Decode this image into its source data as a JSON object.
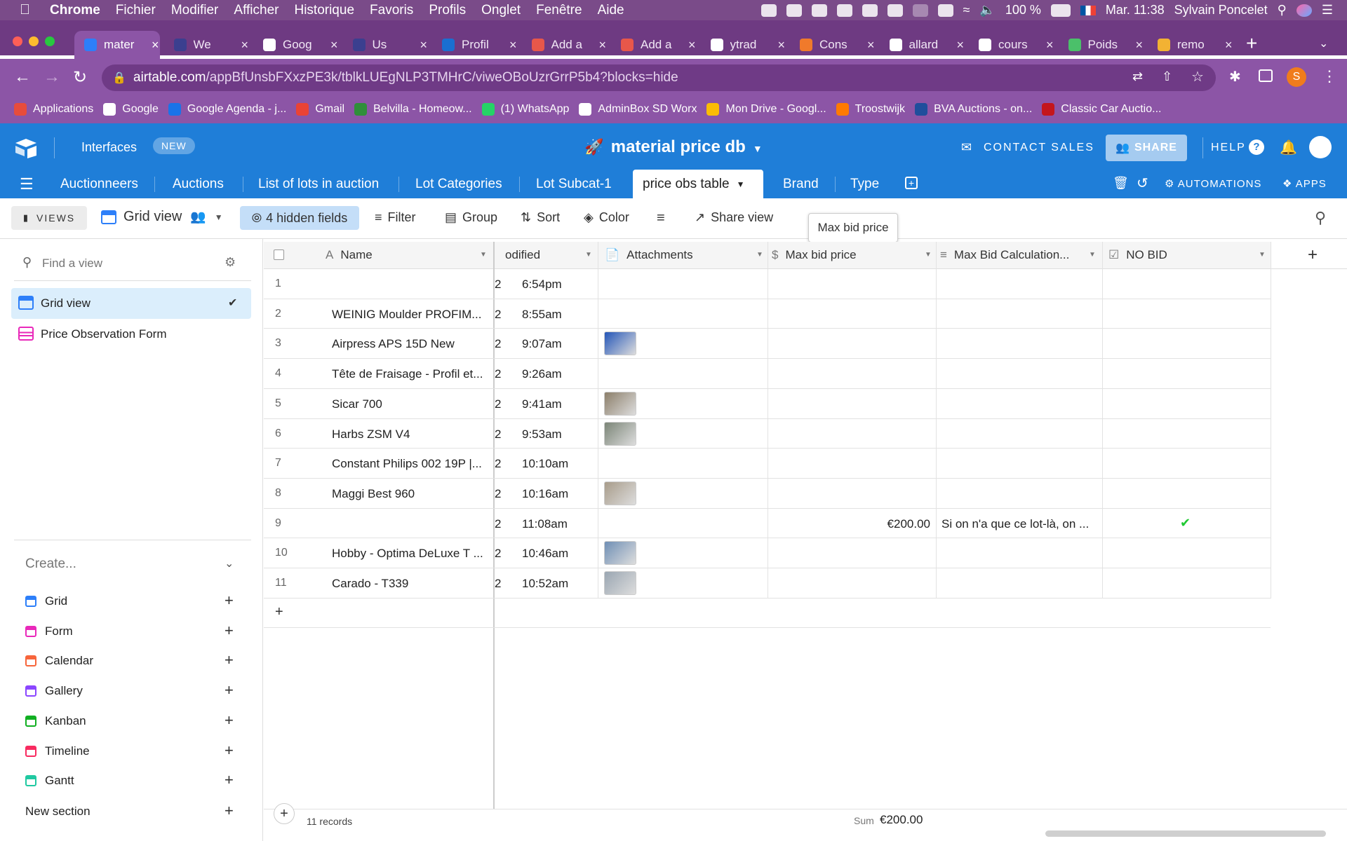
{
  "menubar": {
    "apple": "",
    "app": "Chrome",
    "items": [
      "Fichier",
      "Modifier",
      "Afficher",
      "Historique",
      "Favoris",
      "Profils",
      "Onglet",
      "Fenêtre",
      "Aide"
    ],
    "battery": "100 %",
    "clock": "Mar. 11:38",
    "user": "Sylvain Poncelet"
  },
  "tabs": [
    {
      "label": "mater",
      "color": "#2d7ff9",
      "active": true
    },
    {
      "label": "We",
      "color": "#3b3f8f"
    },
    {
      "label": "Goog",
      "color": "#ffffff"
    },
    {
      "label": "Us",
      "color": "#3b3f8f"
    },
    {
      "label": "Profil",
      "color": "#1a6fd1"
    },
    {
      "label": "Add a",
      "color": "#e8574a"
    },
    {
      "label": "Add a",
      "color": "#e8574a"
    },
    {
      "label": "ytrad",
      "color": "#ffffff"
    },
    {
      "label": "Cons",
      "color": "#f07a2b"
    },
    {
      "label": "allard",
      "color": "#ffffff"
    },
    {
      "label": "cours",
      "color": "#ffffff"
    },
    {
      "label": "Poids",
      "color": "#4bc06a"
    },
    {
      "label": "remo",
      "color": "#f2b233"
    }
  ],
  "newtab": "+",
  "address": {
    "host": "airtable.com",
    "path": "/appBfUnsbFXxzPE3k/tblkLUEgNLP3TMHrC/viweOBoUzrGrrP5b4?blocks=hide"
  },
  "profile_initial": "S",
  "bookmarks": [
    {
      "label": "Applications",
      "color": "#e74c3c"
    },
    {
      "label": "Google",
      "color": "#ffffff"
    },
    {
      "label": "Google Agenda - j...",
      "color": "#1a73e8"
    },
    {
      "label": "Gmail",
      "color": "#ea4335"
    },
    {
      "label": "Belvilla - Homeow...",
      "color": "#2f8f3a"
    },
    {
      "label": "(1) WhatsApp",
      "color": "#25d366"
    },
    {
      "label": "AdminBox SD Worx",
      "color": "#ffffff"
    },
    {
      "label": "Mon Drive - Googl...",
      "color": "#fbbc05"
    },
    {
      "label": "Troostwijk",
      "color": "#ff7a00"
    },
    {
      "label": "BVA Auctions - on...",
      "color": "#1f4e9c"
    },
    {
      "label": "Classic Car Auctio...",
      "color": "#c4161c"
    }
  ],
  "airtable": {
    "interfaces": "Interfaces",
    "new_badge": "NEW",
    "base_name": "material price db",
    "contact_sales": "CONTACT SALES",
    "share": "SHARE",
    "help": "HELP",
    "tables": [
      "Auctionneers",
      "Auctions",
      "List of lots in auction",
      "Lot Categories",
      "Lot Subcat-1",
      "price obs table",
      "Brand",
      "Type"
    ],
    "active_table_index": 5,
    "automations": "AUTOMATIONS",
    "apps": "APPS"
  },
  "toolbar": {
    "views": "VIEWS",
    "view_name": "Grid view",
    "hidden_fields": "4 hidden fields",
    "filter": "Filter",
    "group": "Group",
    "sort": "Sort",
    "color": "Color",
    "share_view": "Share view",
    "tooltip": "Max bid price"
  },
  "sidebar": {
    "find_placeholder": "Find a view",
    "views": [
      {
        "label": "Grid view",
        "icon": "grid",
        "selected": true
      },
      {
        "label": "Price Observation Form",
        "icon": "form",
        "selected": false
      }
    ],
    "create_label": "Create...",
    "create_items": [
      {
        "label": "Grid",
        "color": "#2d7ff9"
      },
      {
        "label": "Form",
        "color": "#e929ba"
      },
      {
        "label": "Calendar",
        "color": "#f7653b"
      },
      {
        "label": "Gallery",
        "color": "#8b46ff"
      },
      {
        "label": "Kanban",
        "color": "#11af22"
      },
      {
        "label": "Timeline",
        "color": "#f82b60"
      },
      {
        "label": "Gantt",
        "color": "#20c9a1"
      }
    ],
    "new_section": "New section"
  },
  "grid": {
    "columns": {
      "name": "Name",
      "modified": "odified",
      "attachments": "Attachments",
      "max_bid": "Max bid price",
      "max_calc": "Max Bid Calculation...",
      "no_bid": "NO BID"
    },
    "rows": [
      {
        "n": "1",
        "name": "",
        "mod_prefix": "2",
        "time": "6:54pm",
        "thumb": "",
        "max": "",
        "calc": "",
        "nobid": false
      },
      {
        "n": "2",
        "name": "WEINIG Moulder PROFIM...",
        "mod_prefix": "2",
        "time": "8:55am",
        "thumb": "",
        "max": "",
        "calc": "",
        "nobid": false
      },
      {
        "n": "3",
        "name": "Airpress APS 15D New",
        "mod_prefix": "2",
        "time": "9:07am",
        "thumb": "#2456b8",
        "max": "",
        "calc": "",
        "nobid": false
      },
      {
        "n": "4",
        "name": "Tête de Fraisage - Profil et...",
        "mod_prefix": "2",
        "time": "9:26am",
        "thumb": "",
        "max": "",
        "calc": "",
        "nobid": false
      },
      {
        "n": "5",
        "name": "Sicar 700",
        "mod_prefix": "2",
        "time": "9:41am",
        "thumb": "#8c7f6a",
        "max": "",
        "calc": "",
        "nobid": false
      },
      {
        "n": "6",
        "name": "Harbs ZSM V4",
        "mod_prefix": "2",
        "time": "9:53am",
        "thumb": "#7b8577",
        "max": "",
        "calc": "",
        "nobid": false
      },
      {
        "n": "7",
        "name": "Constant Philips 002 19P |...",
        "mod_prefix": "2",
        "time": "10:10am",
        "thumb": "",
        "max": "",
        "calc": "",
        "nobid": false
      },
      {
        "n": "8",
        "name": "Maggi Best 960",
        "mod_prefix": "2",
        "time": "10:16am",
        "thumb": "#a89c8a",
        "max": "",
        "calc": "",
        "nobid": false
      },
      {
        "n": "9",
        "name": "",
        "mod_prefix": "2",
        "time": "11:08am",
        "thumb": "",
        "max": "€200.00",
        "calc": "Si on n'a que ce lot-là, on ...",
        "nobid": true
      },
      {
        "n": "10",
        "name": "Hobby - Optima DeLuxe T ...",
        "mod_prefix": "2",
        "time": "10:46am",
        "thumb": "#6f8fb5",
        "max": "",
        "calc": "",
        "nobid": false
      },
      {
        "n": "11",
        "name": "Carado - T339",
        "mod_prefix": "2",
        "time": "10:52am",
        "thumb": "#9aa6b2",
        "max": "",
        "calc": "",
        "nobid": false
      }
    ],
    "record_count": "11 records",
    "sum_label": "Sum",
    "sum_value": "€200.00"
  }
}
